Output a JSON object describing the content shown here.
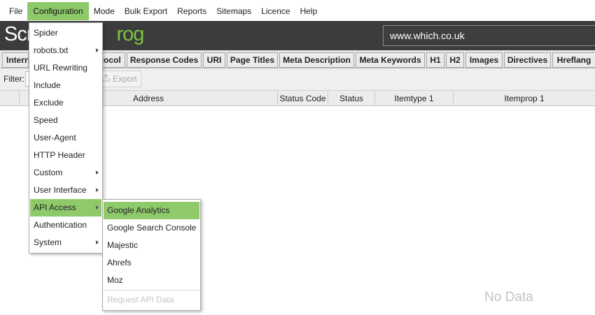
{
  "menubar": {
    "items": [
      "File",
      "Configuration",
      "Mode",
      "Bulk Export",
      "Reports",
      "Sitemaps",
      "Licence",
      "Help"
    ],
    "active": "Configuration"
  },
  "header": {
    "logo_left": "Scr",
    "logo_right": "rog",
    "url": "www.which.co.uk"
  },
  "tabs": [
    "Intern",
    "tocol",
    "Response Codes",
    "URI",
    "Page Titles",
    "Meta Description",
    "Meta Keywords",
    "H1",
    "H2",
    "Images",
    "Directives",
    "Hreflang"
  ],
  "filter": {
    "label": "Filter:",
    "export_label": "Export"
  },
  "grid": {
    "columns": [
      "Address",
      "Status Code",
      "Status",
      "Itemtype 1",
      "Itemprop 1"
    ],
    "empty_text": "No Data"
  },
  "config_menu": {
    "items": [
      {
        "label": "Spider"
      },
      {
        "label": "robots.txt"
      },
      {
        "label": "URL Rewriting"
      },
      {
        "label": "Include"
      },
      {
        "label": "Exclude"
      },
      {
        "label": "Speed"
      },
      {
        "label": "User-Agent"
      },
      {
        "label": "HTTP Header"
      },
      {
        "label": "Custom"
      },
      {
        "label": "User Interface"
      },
      {
        "label": "API Access"
      },
      {
        "label": "Authentication"
      },
      {
        "label": "System"
      }
    ],
    "highlighted": "API Access"
  },
  "api_menu": {
    "items": [
      {
        "label": "Google Analytics"
      },
      {
        "label": "Google Search Console"
      },
      {
        "label": "Majestic"
      },
      {
        "label": "Ahrefs"
      },
      {
        "label": "Moz"
      },
      {
        "label": "Request API Data"
      }
    ],
    "highlighted": "Google Analytics",
    "disabled": "Request API Data"
  },
  "colors": {
    "accent": "#8ec96a",
    "header_bg": "#3c3c3c",
    "logo_green": "#7dc242"
  },
  "icons": {
    "export": "export-icon",
    "submenu": "chevron-right-icon"
  }
}
